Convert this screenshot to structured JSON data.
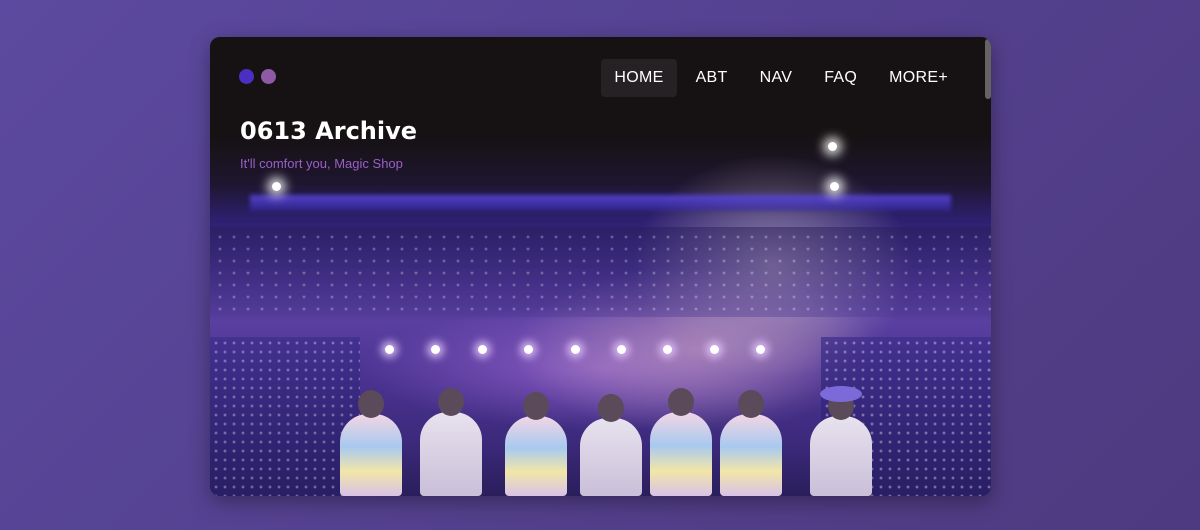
{
  "window": {
    "dots": [
      "#4b2fc2",
      "#8e5aa6"
    ]
  },
  "nav": {
    "items": [
      {
        "label": "HOME",
        "active": true
      },
      {
        "label": "ABT",
        "active": false
      },
      {
        "label": "NAV",
        "active": false
      },
      {
        "label": "FAQ",
        "active": false
      },
      {
        "label": "MORE+",
        "active": false
      }
    ]
  },
  "header": {
    "title": "0613 Archive",
    "subtitle": "It'll comfort you, Magic Shop"
  },
  "colors": {
    "accent": "#9a5fc7",
    "background": "#5a47a0"
  }
}
